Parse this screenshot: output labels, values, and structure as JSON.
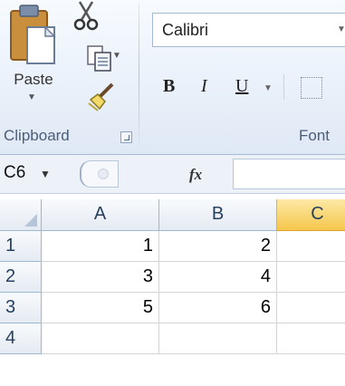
{
  "ribbon": {
    "clipboard": {
      "paste_label": "Paste",
      "group_label": "Clipboard",
      "icons": [
        "paste-icon",
        "cut-icon",
        "copy-icon",
        "format-painter-icon",
        "dialog-launcher-icon"
      ]
    },
    "font": {
      "font_name": "Calibri",
      "bold_label": "B",
      "italic_label": "I",
      "underline_label": "U",
      "group_label": "Font"
    }
  },
  "formula_bar": {
    "name_box": "C6",
    "fx_label": "fx",
    "formula": ""
  },
  "sheet": {
    "columns": [
      "A",
      "B",
      "C"
    ],
    "active_column": "C",
    "rows": [
      {
        "row": "1",
        "A": "1",
        "B": "2",
        "C": ""
      },
      {
        "row": "2",
        "A": "3",
        "B": "4",
        "C": ""
      },
      {
        "row": "3",
        "A": "5",
        "B": "6",
        "C": ""
      },
      {
        "row": "4",
        "A": "",
        "B": "",
        "C": ""
      }
    ]
  },
  "colors": {
    "active_header": "#f5c74b",
    "header_border": "#9eb6ce",
    "gridline": "#d4d4d4"
  }
}
